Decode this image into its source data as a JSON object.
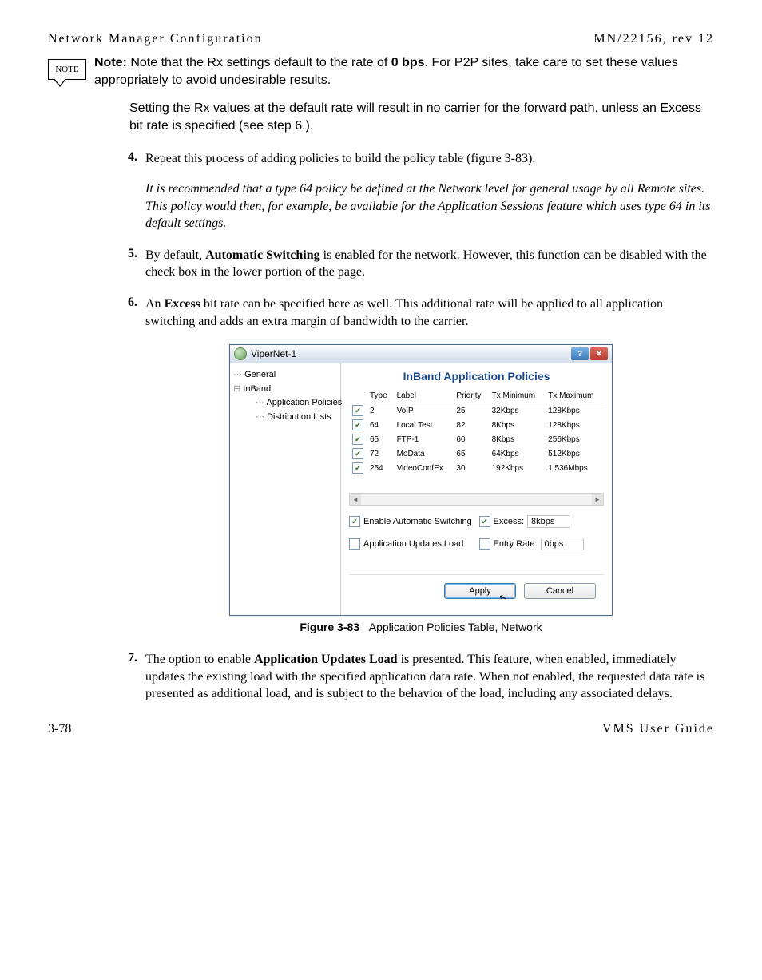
{
  "header": {
    "left": "Network Manager Configuration",
    "right": "MN/22156, rev 12"
  },
  "note": {
    "icon_label": "NOTE",
    "label": "Note:",
    "para1a": "Note that the Rx settings default to the rate of ",
    "bold1": "0 bps",
    "para1b": ". For P2P sites, take care to set these values appropriately to avoid undesirable results.",
    "para2": "Setting the Rx values at the default rate will result in no carrier for the forward path, unless an Excess bit rate is specified (see step 6.)."
  },
  "steps": {
    "s4": {
      "num": "4.",
      "text": "Repeat this process of adding policies to build the policy table (figure 3-83).",
      "italic": "It is recommended that a type 64 policy be defined at the Network level for general usage by all Remote sites. This policy would then, for example, be available for the Application Sessions feature which uses type 64 in its default settings"
    },
    "s5": {
      "num": "5.",
      "a": "By default, ",
      "bold": "Automatic Switching",
      "b": " is enabled for the network. However, this function can be disabled with the check box in the lower portion of the page."
    },
    "s6": {
      "num": "6.",
      "a": "An ",
      "bold": "Excess",
      "b": " bit rate can be specified here as well. This additional rate will be applied to all application switching and adds an extra margin of bandwidth to the carrier."
    },
    "s7": {
      "num": "7.",
      "a": "The option to enable ",
      "bold": "Application Updates Load",
      "b": " is presented. This feature, when enabled, immediately updates the existing load with the specified application data rate. When not enabled, the requested data rate is presented as additional load, and is subject to the behavior of the load, including any associated delays."
    }
  },
  "dialog": {
    "title": "ViperNet-1",
    "tree": {
      "general": "General",
      "inband": "InBand",
      "app_policies": "Application Policies",
      "dist_lists": "Distribution Lists"
    },
    "heading": "InBand Application Policies",
    "columns": {
      "type": "Type",
      "label": "Label",
      "priority": "Priority",
      "txmin": "Tx Minimum",
      "txmax": "Tx Maximum"
    },
    "rows": [
      {
        "chk": true,
        "type": "2",
        "label": "VoIP",
        "priority": "25",
        "txmin": "32Kbps",
        "txmax": "128Kbps"
      },
      {
        "chk": true,
        "type": "64",
        "label": "Local Test",
        "priority": "82",
        "txmin": "8Kbps",
        "txmax": "128Kbps"
      },
      {
        "chk": true,
        "type": "65",
        "label": "FTP-1",
        "priority": "60",
        "txmin": "8Kbps",
        "txmax": "256Kbps"
      },
      {
        "chk": true,
        "type": "72",
        "label": "MoData",
        "priority": "65",
        "txmin": "64Kbps",
        "txmax": "512Kbps"
      },
      {
        "chk": true,
        "type": "254",
        "label": "VideoConfEx",
        "priority": "30",
        "txmin": "192Kbps",
        "txmax": "1.536Mbps"
      }
    ],
    "opts": {
      "enable_auto": "Enable Automatic Switching",
      "excess": "Excess:",
      "excess_val": "8kbps",
      "app_updates": "Application Updates Load",
      "entry_rate": "Entry Rate:",
      "entry_rate_val": "0bps"
    },
    "footer": {
      "apply": "Apply",
      "cancel": "Cancel"
    }
  },
  "figure": {
    "label": "Figure 3-83",
    "caption": "Application Policies Table, Network"
  },
  "footer": {
    "left": "3-78",
    "right": "VMS User Guide"
  }
}
